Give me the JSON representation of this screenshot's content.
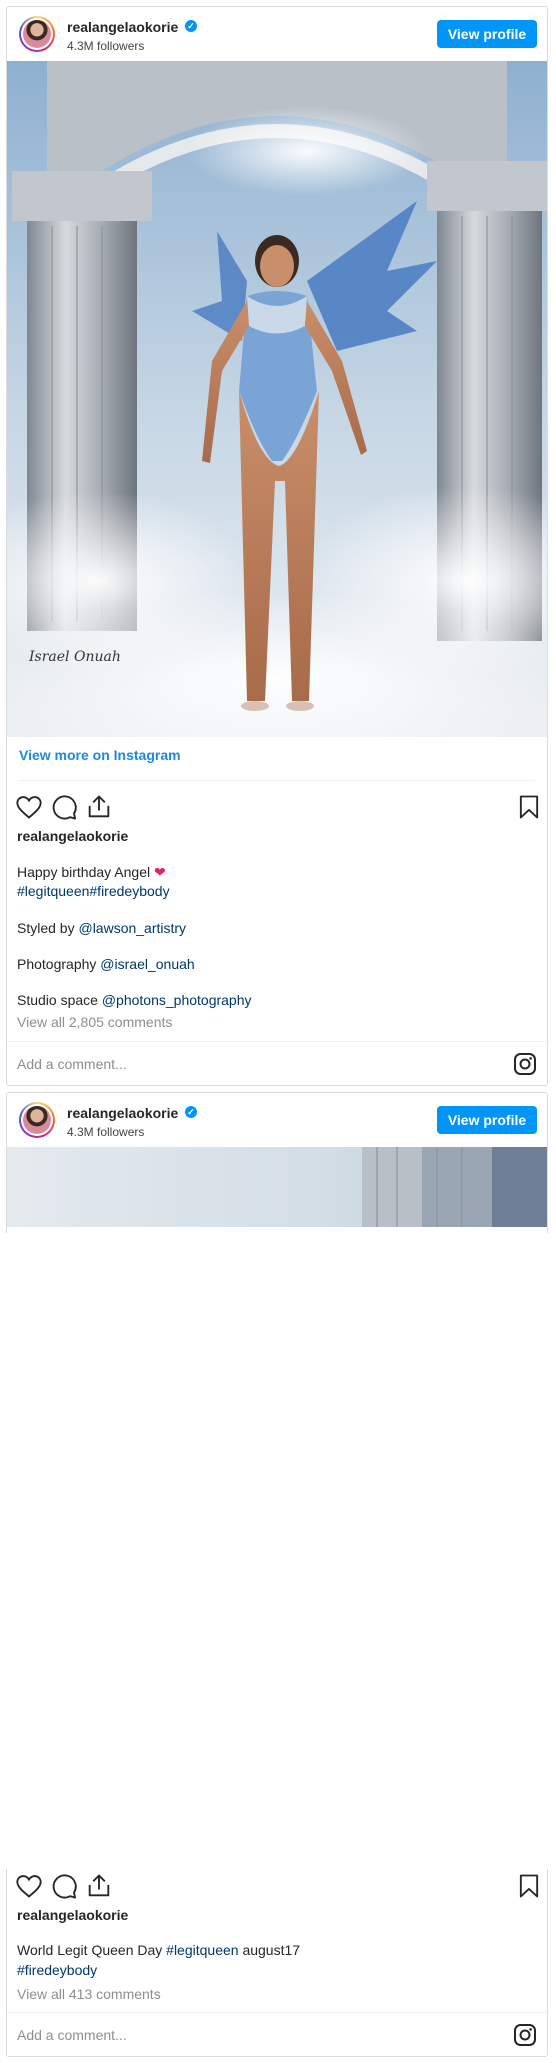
{
  "posts": [
    {
      "username": "realangelaokorie",
      "followers": "4.3M followers",
      "view_profile": "View profile",
      "view_more": "View more on Instagram",
      "liker_username": "realangelaokorie",
      "caption": {
        "line1": "Happy birthday Angel",
        "heart": "❤",
        "hashtags": "#legitqueen#firedeybody",
        "styled_prefix": "Styled by",
        "styled_handle": "@lawson_artistry",
        "photo_prefix": "Photography",
        "photo_handle": "@israel_onuah",
        "studio_prefix": "Studio space",
        "studio_handle": "@photons_photography"
      },
      "view_all_comments": "View all 2,805 comments",
      "add_comment": "Add a comment...",
      "signature": "Israel Onuah"
    },
    {
      "username": "realangelaokorie",
      "followers": "4.3M followers",
      "view_profile": "View profile",
      "liker_username": "realangelaokorie",
      "caption": {
        "text": "World Legit Queen Day",
        "hashtag1": "#legitqueen",
        "suffix": "august17",
        "hashtag2": "#firedeybody"
      },
      "view_all_comments": "View all 413 comments",
      "add_comment": "Add a comment..."
    }
  ],
  "colors": {
    "accent": "#0095f6",
    "link": "#1e88e5",
    "hashtag": "#00376b",
    "muted": "#8e8e8e",
    "border": "#dbdbdb"
  },
  "icons": [
    "verified-badge-icon",
    "heart-icon",
    "comment-icon",
    "share-icon",
    "bookmark-icon",
    "instagram-icon"
  ]
}
